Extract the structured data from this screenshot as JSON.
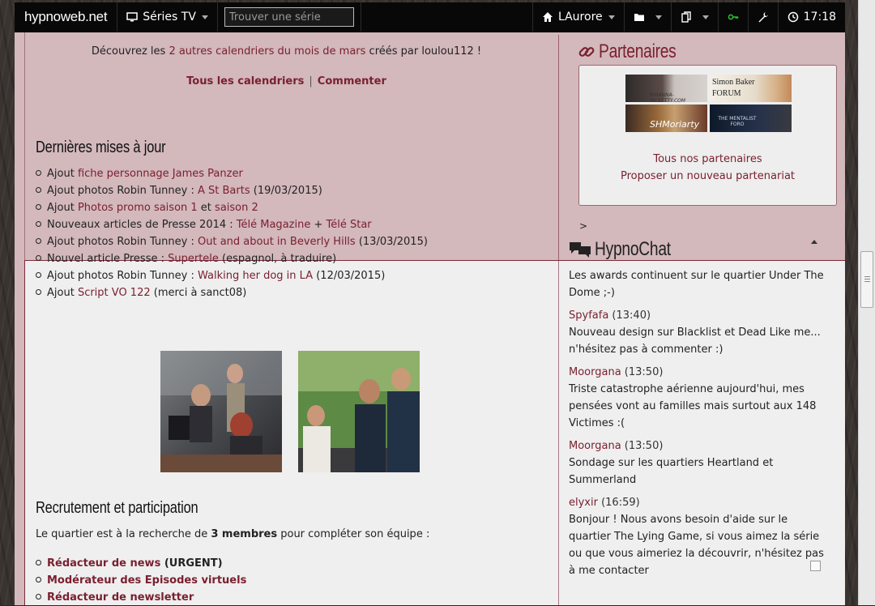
{
  "navbar": {
    "brand": "hypnoweb.net",
    "series_menu": "Séries TV",
    "search_placeholder": "Trouver une série",
    "user_menu": "LAurore",
    "time": "17:18"
  },
  "intro": {
    "prefix": "Découvrez les ",
    "link": "2 autres calendriers du mois de mars",
    "suffix": " créés par loulou112 !",
    "all_calendars": "Tous les calendriers",
    "separator": "|",
    "comment": "Commenter"
  },
  "updates": {
    "title": "Dernières mises à jour",
    "items": [
      {
        "pre": "Ajout ",
        "link": "fiche personnage James Panzer",
        "mid": "",
        "link2": "",
        "post": ""
      },
      {
        "pre": "Ajout photos Robin Tunney : ",
        "link": "A St Barts",
        "mid": "",
        "link2": "",
        "post": " (19/03/2015)"
      },
      {
        "pre": "Ajout ",
        "link": "Photos promo saison 1",
        "mid": " et ",
        "link2": "saison 2",
        "post": ""
      },
      {
        "pre": "Nouveaux articles de Presse 2014 : ",
        "link": "Télé Magazine",
        "mid": " + ",
        "link2": "Télé Star",
        "post": ""
      },
      {
        "pre": "Ajout photos Robin Tunney : ",
        "link": "Out and about in Beverly Hills",
        "mid": "",
        "link2": "",
        "post": " (13/03/2015)"
      },
      {
        "pre": "Nouvel article Presse : ",
        "link": "Supertele",
        "mid": "",
        "link2": "",
        "post": " (espagnol, à traduire)"
      },
      {
        "pre": "Ajout photos Robin Tunney : ",
        "link": "Walking her dog in LA",
        "mid": "",
        "link2": "",
        "post": " (12/03/2015)"
      },
      {
        "pre": "Ajout ",
        "link": "Script VO 122",
        "mid": "",
        "link2": "",
        "post": " (merci à sanct08)"
      }
    ]
  },
  "recruit": {
    "title": "Recrutement et participation",
    "text_pre": "Le quartier est à la recherche de ",
    "text_bold": "3 membres",
    "text_post": " pour compléter son équipe :",
    "roles": [
      {
        "label": "Rédacteur de news",
        "note": " (URGENT)"
      },
      {
        "label": "Modérateur des Episodes virtuels",
        "note": ""
      },
      {
        "label": "Rédacteur de newsletter",
        "note": ""
      }
    ]
  },
  "partners": {
    "title": "Partenaires",
    "banners": [
      "RHIANNA-RICKETTY.COM",
      "Simon Baker FORUM",
      "SHMoriarty",
      "THE MENTALIST FORO"
    ],
    "link_all": "Tous nos partenaires",
    "link_propose": "Proposer un nouveau partenariat"
  },
  "chat": {
    "marker": ">",
    "title": "HypnoChat",
    "messages": [
      {
        "author": "",
        "time": "",
        "text": "Les awards continuent sur le quartier Under The Dome ;-)"
      },
      {
        "author": "Spyfafa",
        "time": " (13:40)",
        "text": "Nouveau design sur Blacklist et Dead Like me... n'hésitez pas à commenter :)"
      },
      {
        "author": "Moorgana",
        "time": " (13:50)",
        "text": "Triste catastrophe aérienne aujourd'hui, mes pensées vont au familles mais surtout aux 148 Victimes :("
      },
      {
        "author": "Moorgana",
        "time": " (13:50)",
        "text": "Sondage sur les quartiers Heartland et Summerland"
      },
      {
        "author": "elyxir",
        "time": " (16:59)",
        "text": "Bonjour ! Nous avons besoin d'aide sur le quartier The Lying Game, si vous aimez la série ou que vous aimeriez la découvrir, n'hésitez pas à me contacter"
      }
    ]
  },
  "colors": {
    "accent": "#7a2030",
    "panel": "#d3b8bc",
    "content": "#efefef",
    "navbar": "#080808"
  }
}
